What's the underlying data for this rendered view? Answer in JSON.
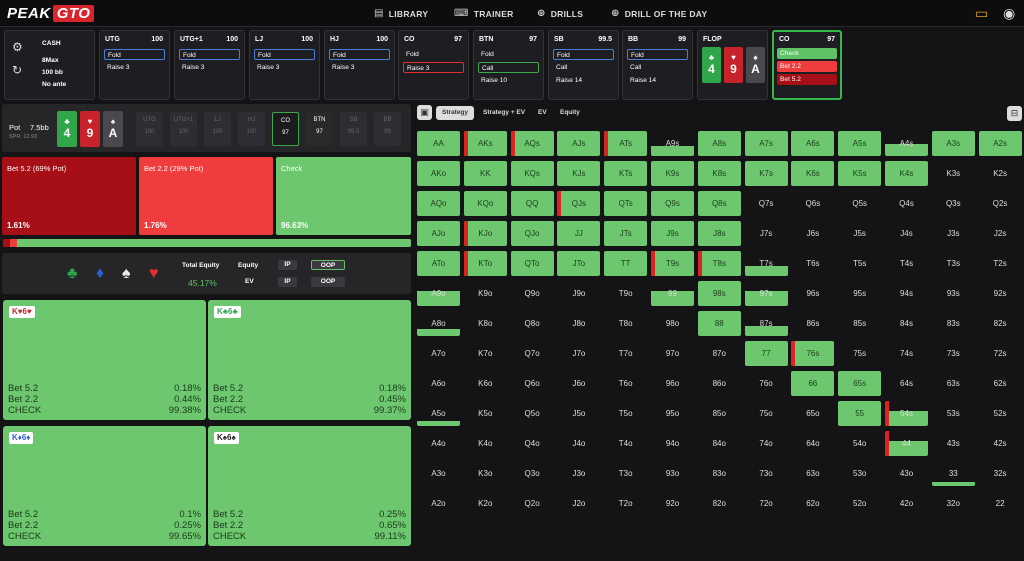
{
  "nav": {
    "logo_a": "PEAK",
    "logo_b": "GTO",
    "links": [
      {
        "label": "LIBRARY",
        "icon": "book-icon"
      },
      {
        "label": "TRAINER",
        "icon": "gamepad-icon"
      },
      {
        "label": "DRILLS",
        "icon": "globe-icon"
      },
      {
        "label": "DRILL OF THE DAY",
        "icon": "plus-circle-icon"
      }
    ]
  },
  "config": {
    "game": "CASH",
    "max": "8Max",
    "stack": "100 bb",
    "ante": "No ante"
  },
  "positions": [
    {
      "name": "UTG",
      "stack": "100",
      "rows": [
        {
          "t": "Fold",
          "sel": "blue"
        },
        {
          "t": "Raise 3",
          "sel": ""
        }
      ]
    },
    {
      "name": "UTG+1",
      "stack": "100",
      "rows": [
        {
          "t": "Fold",
          "sel": "blue"
        },
        {
          "t": "Raise 3",
          "sel": ""
        }
      ]
    },
    {
      "name": "LJ",
      "stack": "100",
      "rows": [
        {
          "t": "Fold",
          "sel": "blue"
        },
        {
          "t": "Raise 3",
          "sel": ""
        }
      ]
    },
    {
      "name": "HJ",
      "stack": "100",
      "rows": [
        {
          "t": "Fold",
          "sel": "blue"
        },
        {
          "t": "Raise 3",
          "sel": ""
        }
      ]
    },
    {
      "name": "CO",
      "stack": "97",
      "rows": [
        {
          "t": "Fold",
          "sel": ""
        },
        {
          "t": "Raise 3",
          "sel": "red"
        }
      ]
    },
    {
      "name": "BTN",
      "stack": "97",
      "rows": [
        {
          "t": "Fold",
          "sel": ""
        },
        {
          "t": "Call",
          "sel": "green"
        },
        {
          "t": "Raise 10",
          "sel": ""
        }
      ]
    },
    {
      "name": "SB",
      "stack": "99.5",
      "rows": [
        {
          "t": "Fold",
          "sel": "blue"
        },
        {
          "t": "Call",
          "sel": ""
        },
        {
          "t": "Raise 14",
          "sel": ""
        }
      ]
    },
    {
      "name": "BB",
      "stack": "99",
      "rows": [
        {
          "t": "Fold",
          "sel": "blue"
        },
        {
          "t": "Call",
          "sel": ""
        },
        {
          "t": "Raise 14",
          "sel": ""
        }
      ]
    }
  ],
  "flop": {
    "label": "FLOP",
    "cards": [
      {
        "v": "4",
        "s": "♣",
        "c": "#2fa64a"
      },
      {
        "v": "9",
        "s": "♥",
        "c": "#c8222a"
      },
      {
        "v": "A",
        "s": "♠",
        "c": "#4a4a4e"
      }
    ]
  },
  "co_action": {
    "name": "CO",
    "stack": "97",
    "opts": [
      "Check",
      "Bet 2.2",
      "Bet 5.2"
    ]
  },
  "pot": {
    "label": "Pot",
    "value": "7.5bb",
    "spr": "SPR: 12.93"
  },
  "seats": [
    {
      "n": "UTG",
      "s": "100"
    },
    {
      "n": "UTG+1",
      "s": "100"
    },
    {
      "n": "LJ",
      "s": "100"
    },
    {
      "n": "HJ",
      "s": "100"
    },
    {
      "n": "CO",
      "s": "97",
      "active": true
    },
    {
      "n": "BTN",
      "s": "97",
      "btn": true
    },
    {
      "n": "SB",
      "s": "99.5"
    },
    {
      "n": "BB",
      "s": "99"
    }
  ],
  "actions": [
    {
      "label": "Bet 5.2 (69% Pot)",
      "pct": "1.61%",
      "color": "#a50f15",
      "freq": 1.61
    },
    {
      "label": "Bet 2.2 (29% Pot)",
      "pct": "1.76%",
      "color": "#ef3d3d",
      "freq": 1.76
    },
    {
      "label": "Check",
      "pct": "96.63%",
      "color": "#6cc76f",
      "freq": 96.63
    }
  ],
  "equity": {
    "total_label": "Total Equity",
    "total": "45.17%",
    "eq_label": "Equity",
    "ev_label": "EV",
    "ip": "IP",
    "oop": "OOP"
  },
  "combos": [
    {
      "hand": "K♥6♥",
      "suit_color": "#c8222a",
      "bet52": "0.18%",
      "bet22": "0.44%",
      "check": "99.38%"
    },
    {
      "hand": "K♣6♣",
      "suit_color": "#2fa64a",
      "bet52": "0.18%",
      "bet22": "0.45%",
      "check": "99.37%"
    },
    {
      "hand": "K♦6♦",
      "suit_color": "#2a5fd0",
      "bet52": "0.1%",
      "bet22": "0.25%",
      "check": "99.65%"
    },
    {
      "hand": "K♠6♠",
      "suit_color": "#222222",
      "bet52": "0.25%",
      "bet22": "0.65%",
      "check": "99.11%"
    }
  ],
  "combo_labels": {
    "b52": "Bet 5.2",
    "b22": "Bet 2.2",
    "chk": "CHECK"
  },
  "tabs": [
    "Strategy",
    "Strategy + EV",
    "EV",
    "Equity"
  ],
  "grid": {
    "ranks": [
      "A",
      "K",
      "Q",
      "J",
      "T",
      "9",
      "8",
      "7",
      "6",
      "5",
      "4",
      "3",
      "2"
    ],
    "range": [
      [
        1,
        1,
        1,
        1,
        1,
        0.4,
        1,
        1,
        1,
        1,
        0.5,
        1,
        1
      ],
      [
        1,
        1,
        1,
        1,
        1,
        1,
        1,
        1,
        1,
        1,
        1,
        0,
        0
      ],
      [
        1,
        1,
        1,
        1,
        1,
        1,
        1,
        0,
        0,
        0,
        0,
        0,
        0
      ],
      [
        1,
        1,
        1,
        1,
        1,
        1,
        1,
        0,
        0,
        0,
        0,
        0,
        0
      ],
      [
        1,
        1,
        1,
        1,
        1,
        1,
        1,
        0.4,
        0,
        0,
        0,
        0,
        0
      ],
      [
        0.6,
        0,
        0,
        0,
        0,
        0.6,
        1,
        0.6,
        0,
        0,
        0,
        0,
        0
      ],
      [
        0.3,
        0,
        0,
        0,
        0,
        0,
        1,
        0.4,
        0,
        0,
        0,
        0,
        0
      ],
      [
        0,
        0,
        0,
        0,
        0,
        0,
        0,
        1,
        1,
        0,
        0,
        0,
        0
      ],
      [
        0,
        0,
        0,
        0,
        0,
        0,
        0,
        0,
        1,
        1,
        0,
        0,
        0
      ],
      [
        0.2,
        0,
        0,
        0,
        0,
        0,
        0,
        0,
        0,
        1,
        0.6,
        0,
        0
      ],
      [
        0,
        0,
        0,
        0,
        0,
        0,
        0,
        0,
        0,
        0,
        0.6,
        0,
        0
      ],
      [
        0,
        0,
        0,
        0,
        0,
        0,
        0,
        0,
        0,
        0,
        0,
        0.15,
        0
      ],
      [
        0,
        0,
        0,
        0,
        0,
        0,
        0,
        0,
        0,
        0,
        0,
        0,
        0
      ]
    ],
    "red": [
      [
        0,
        1,
        1,
        0,
        1,
        0,
        0,
        0,
        0,
        0,
        0,
        0,
        0
      ],
      [
        0,
        0,
        0,
        0,
        0,
        0,
        0,
        0,
        0,
        0,
        0,
        0,
        0
      ],
      [
        0,
        0,
        0,
        1,
        0,
        0,
        0,
        0,
        0,
        0,
        0,
        0,
        0
      ],
      [
        0,
        1,
        0,
        0,
        0,
        0,
        0,
        0,
        0,
        0,
        0,
        0,
        0
      ],
      [
        0,
        1,
        0,
        0,
        0,
        1,
        1,
        0,
        0,
        0,
        0,
        0,
        0
      ],
      [
        0,
        0,
        0,
        0,
        0,
        0,
        0,
        0,
        0,
        0,
        0,
        0,
        0
      ],
      [
        0,
        0,
        0,
        0,
        0,
        0,
        0,
        0,
        0,
        0,
        0,
        0,
        0
      ],
      [
        0,
        0,
        0,
        0,
        0,
        0,
        0,
        0,
        1,
        0,
        0,
        0,
        0
      ],
      [
        0,
        0,
        0,
        0,
        0,
        0,
        0,
        0,
        0,
        0,
        0,
        0,
        0
      ],
      [
        0,
        0,
        0,
        0,
        0,
        0,
        0,
        0,
        0,
        0,
        1,
        0,
        0
      ],
      [
        0,
        0,
        0,
        0,
        0,
        0,
        0,
        0,
        0,
        0,
        1,
        0,
        0
      ],
      [
        0,
        0,
        0,
        0,
        0,
        0,
        0,
        0,
        0,
        0,
        0,
        0,
        0
      ],
      [
        0,
        0,
        0,
        0,
        0,
        0,
        0,
        0,
        0,
        0,
        0,
        0,
        0
      ]
    ]
  }
}
